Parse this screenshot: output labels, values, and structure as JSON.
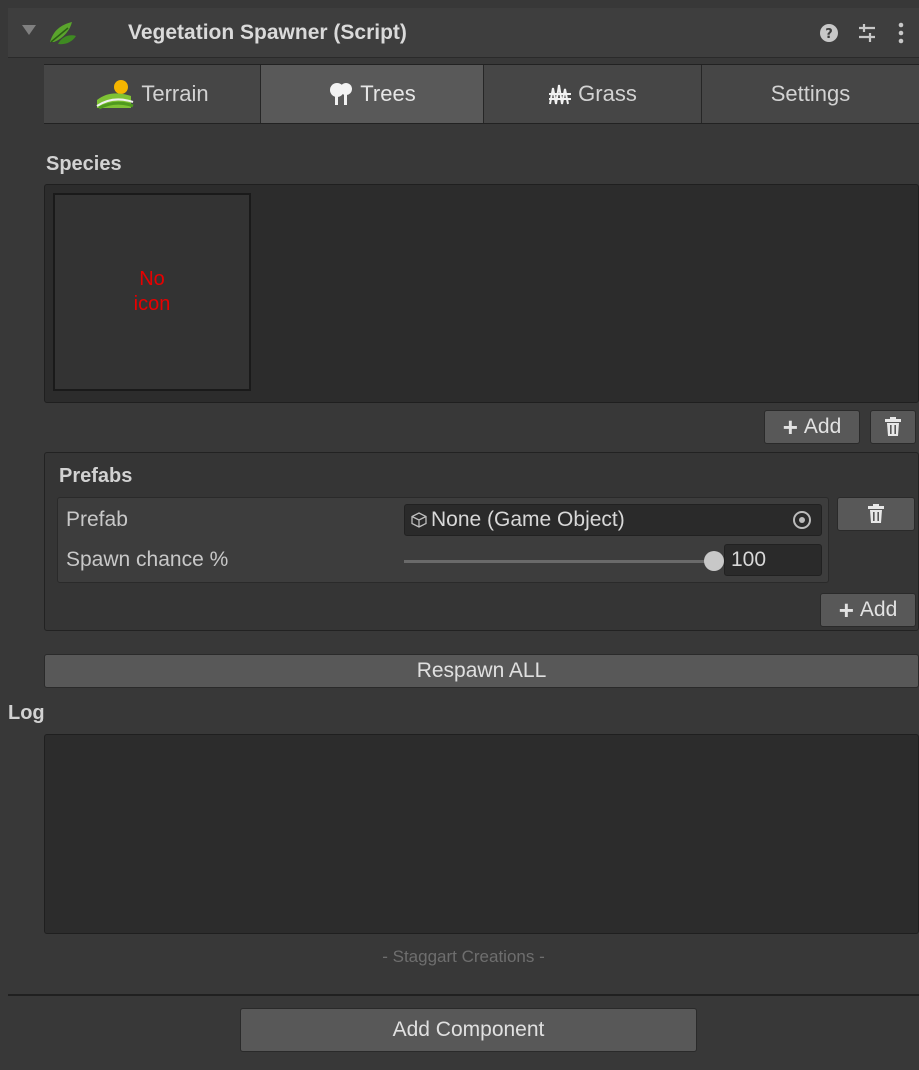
{
  "header": {
    "title": "Vegetation Spawner (Script)",
    "help_icon": "help-icon",
    "preset_icon": "preset-icon",
    "menu_icon": "kebab-menu-icon"
  },
  "tabs": [
    {
      "label": "Terrain",
      "icon": "terrain-icon"
    },
    {
      "label": "Trees",
      "icon": "trees-icon"
    },
    {
      "label": "Grass",
      "icon": "grass-icon"
    },
    {
      "label": "Settings",
      "icon": ""
    }
  ],
  "active_tab": "Trees",
  "species": {
    "label": "Species",
    "tile_text_line1": "No",
    "tile_text_line2": "icon",
    "add_label": "Add"
  },
  "prefabs": {
    "label": "Prefabs",
    "prefab_label": "Prefab",
    "prefab_value": "None (Game Object)",
    "spawn_chance_label": "Spawn chance %",
    "spawn_chance_value": "100",
    "spawn_chance_fraction": 1.0,
    "add_label": "Add"
  },
  "respawn_label": "Respawn ALL",
  "log": {
    "label": "Log"
  },
  "credit": "- Staggart Creations -",
  "add_component_label": "Add Component",
  "colors": {
    "background": "#383838",
    "panel": "#2c2c2c",
    "button": "#585858",
    "active_tab": "#595959",
    "no_icon_text": "#e80000"
  }
}
